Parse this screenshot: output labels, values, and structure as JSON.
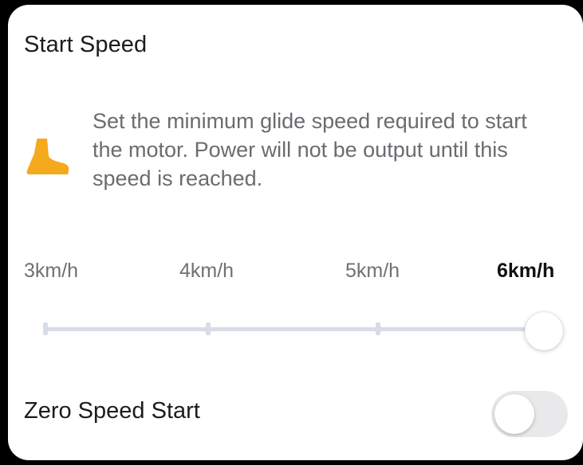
{
  "colors": {
    "background": "#000000",
    "card": "#ffffff",
    "accent_icon": "#f5a91c",
    "track": "#d7dce6",
    "toggle_off": "#e9e9eb"
  },
  "start_speed": {
    "title": "Start Speed",
    "icon": "shoe-icon",
    "description": "Set the minimum glide speed required to start the motor. Power will not be output until this speed is reached.",
    "options": [
      "3km/h",
      "4km/h",
      "5km/h",
      "6km/h"
    ],
    "selected_index": 3,
    "selected_value": "6km/h"
  },
  "zero_speed_start": {
    "label": "Zero Speed Start",
    "enabled": false
  }
}
